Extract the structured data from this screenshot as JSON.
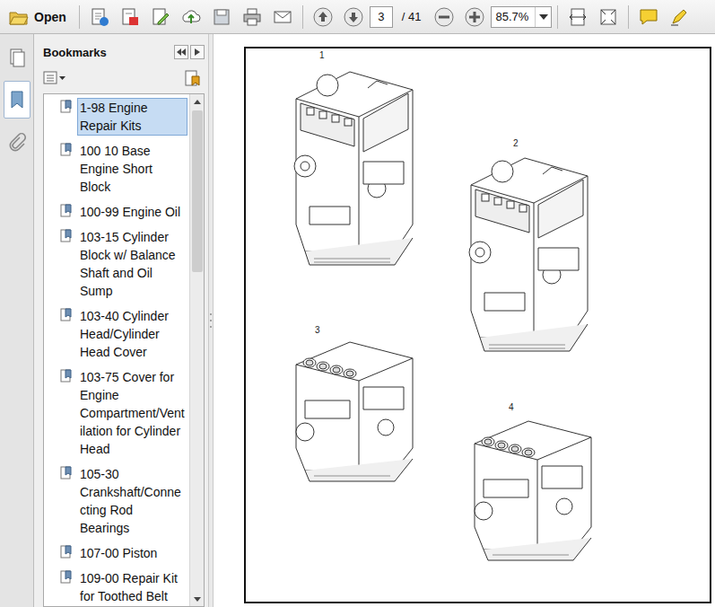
{
  "toolbar": {
    "open_label": "Open",
    "page_current": "3",
    "page_total": "/ 41",
    "zoom": "85.7%"
  },
  "sidebar": {
    "panels": [
      {
        "label": "pages",
        "selected": false
      },
      {
        "label": "bookmarks",
        "selected": true
      },
      {
        "label": "attachments",
        "selected": false
      }
    ]
  },
  "bookmarks": {
    "title": "Bookmarks",
    "items": [
      {
        "label": "1-98 Engine Repair Kits",
        "selected": true
      },
      {
        "label": "100 10  Base Engine Short Block",
        "selected": false
      },
      {
        "label": "100-99  Engine Oil",
        "selected": false
      },
      {
        "label": "103-15  Cylinder Block w/ Balance Shaft and Oil Sump",
        "selected": false
      },
      {
        "label": "103-40  Cylinder Head/Cylinder Head Cover",
        "selected": false
      },
      {
        "label": "103-75  Cover for Engine Compartment/Ventilation for Cylinder Head",
        "selected": false
      },
      {
        "label": "105-30 Crankshaft/Connecting Rod Bearings",
        "selected": false
      },
      {
        "label": "107-00  Piston",
        "selected": false
      },
      {
        "label": "109-00  Repair Kit for Toothed Belt",
        "selected": false
      }
    ]
  },
  "document": {
    "figures": [
      {
        "label": "1",
        "kind": "full"
      },
      {
        "label": "2",
        "kind": "full"
      },
      {
        "label": "3",
        "kind": "short"
      },
      {
        "label": "4",
        "kind": "short"
      }
    ]
  }
}
